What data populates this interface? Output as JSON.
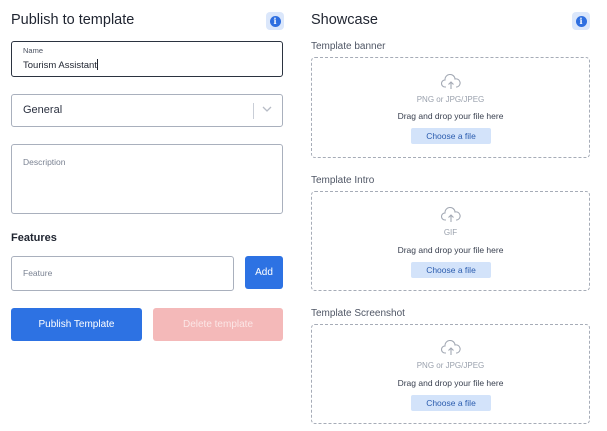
{
  "left_panel": {
    "title": "Publish to template",
    "info_icon": "info-icon",
    "name_field": {
      "label": "Name",
      "value": "Tourism Assistant"
    },
    "category_select": {
      "value": "General",
      "icon": "chevron-down-icon"
    },
    "description_field": {
      "placeholder": "Description"
    },
    "features": {
      "heading": "Features",
      "input_placeholder": "Feature",
      "add_label": "Add"
    },
    "publish_label": "Publish Template",
    "delete_label": "Delete template"
  },
  "right_panel": {
    "title": "Showcase",
    "info_icon": "info-icon",
    "uploads": [
      {
        "label": "Template banner",
        "types": "PNG or JPG/JPEG",
        "drag_text": "Drag and drop your file here",
        "choose_label": "Choose a file",
        "icon": "upload-cloud-icon"
      },
      {
        "label": "Template Intro",
        "types": "GIF",
        "drag_text": "Drag and drop your file here",
        "choose_label": "Choose a file",
        "icon": "upload-cloud-icon"
      },
      {
        "label": "Template Screenshot",
        "types": "PNG or JPG/JPEG",
        "drag_text": "Drag and drop your file here",
        "choose_label": "Choose a file",
        "icon": "upload-cloud-icon"
      }
    ]
  },
  "colors": {
    "accent": "#2d72e3",
    "disabled_danger": "#f4b9b9",
    "choose_bg": "#d3e3fa"
  }
}
